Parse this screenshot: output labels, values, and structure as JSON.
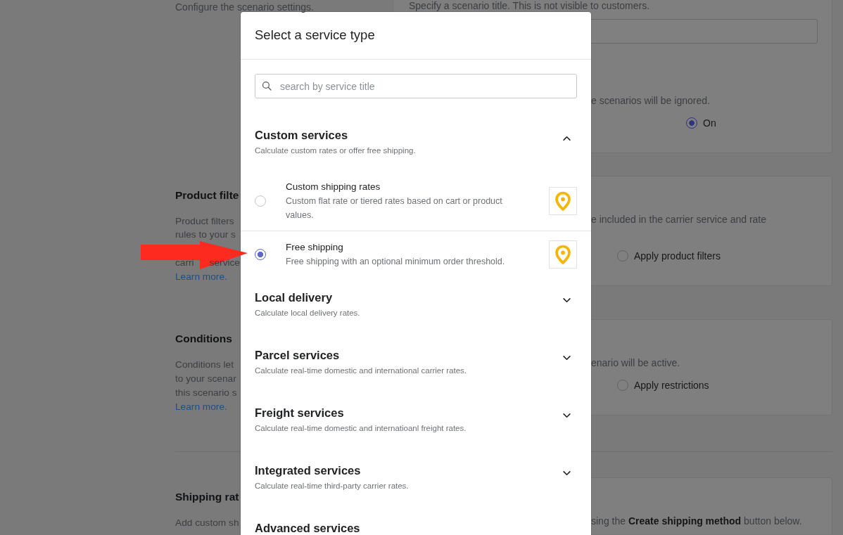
{
  "settings_page": {
    "sections": [
      {
        "lines": [
          {
            "kind": "text",
            "parts": [
              "Configure the scenario settings."
            ]
          }
        ],
        "panels": [
          {
            "kind": "title_field",
            "hint": "Specify a scenario title. This is not visible to customers."
          },
          {
            "kind": "option",
            "lines": [
              {
                "kind": "text",
                "parts": [
                  "e scenarios will be ignored."
                ]
              }
            ],
            "radio": {
              "label": "On",
              "selected": true
            }
          }
        ]
      },
      {
        "title": "Product filte",
        "lines": [
          {
            "kind": "text",
            "parts": [
              "Product filters"
            ]
          },
          {
            "kind": "text",
            "parts": [
              "rules to your s"
            ]
          },
          {
            "kind": "hidden"
          },
          {
            "kind": "text",
            "parts": [
              "carri",
              "service"
            ]
          }
        ],
        "link": "Learn more.",
        "panels": [
          {
            "kind": "option",
            "lines": [
              {
                "kind": "text",
                "parts": [
                  "e included in the carrier service and rate"
                ]
              },
              {
                "kind": "hidden"
              }
            ],
            "radio": {
              "label": "Apply product filters",
              "selected": false
            }
          }
        ]
      },
      {
        "title": "Conditions",
        "lines": [
          {
            "kind": "text",
            "parts": [
              "Conditions let"
            ]
          },
          {
            "kind": "text",
            "parts": [
              "to your scenar"
            ]
          },
          {
            "kind": "text",
            "parts": [
              "this scenario s"
            ]
          }
        ],
        "link": "Learn more.",
        "panels": [
          {
            "kind": "option",
            "lines": [
              {
                "kind": "text",
                "parts": [
                  "enario will be active."
                ]
              }
            ],
            "radio": {
              "label": "Apply restrictions",
              "selected": false
            }
          }
        ]
      },
      {
        "title": "Shipping rat",
        "lines": [
          {
            "kind": "text",
            "parts": [
              "Add custom sh"
            ]
          }
        ],
        "panels": [
          {
            "kind": "text",
            "lines": [
              {
                "kind": "text",
                "parts": [
                  "sing the **Create shipping method** button below."
                ]
              }
            ]
          }
        ]
      }
    ]
  },
  "modal": {
    "title": "Select a service type",
    "search": {
      "placeholder": "search by service title"
    },
    "groups": [
      {
        "title": "Custom services",
        "description": "Calculate custom rates or offer free shipping.",
        "expanded": true,
        "services": [
          {
            "title": "Custom shipping rates",
            "description": "Custom flat rate or tiered rates based on cart or product values.",
            "selected": false
          },
          {
            "title": "Free shipping",
            "description": "Free shipping with an optional minimum order threshold.",
            "selected": true
          }
        ]
      },
      {
        "title": "Local delivery",
        "description": "Calculate local delivery rates.",
        "expanded": false
      },
      {
        "title": "Parcel services",
        "description": "Calculate real-time domestic and international carrier rates.",
        "expanded": false
      },
      {
        "title": "Freight services",
        "description": "Calculate real-time domestic and internatioanl freight rates.",
        "expanded": false
      },
      {
        "title": "Integrated services",
        "description": "Calculate real-time third-party carrier rates.",
        "expanded": false
      },
      {
        "title": "Advanced services"
      }
    ]
  }
}
